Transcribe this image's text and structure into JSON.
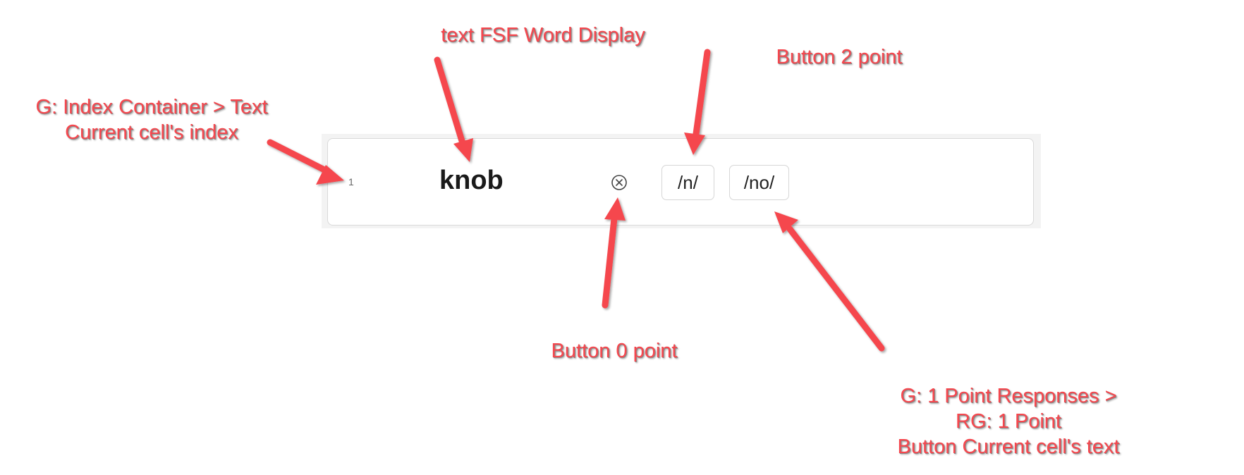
{
  "row": {
    "index": "1",
    "word": "knob",
    "zero_point_icon": "circle-x-icon",
    "two_point_label": "/n/",
    "one_point_label": "/no/"
  },
  "annotations": {
    "index_lines": [
      "G: Index Container > Text",
      "Current cell's index"
    ],
    "word_lines": [
      "text FSF Word Display"
    ],
    "two_point_lines": [
      "Button 2 point"
    ],
    "zero_point_lines": [
      "Button 0 point"
    ],
    "one_point_lines": [
      "G: 1 Point Responses >",
      "RG: 1 Point",
      "Button Current cell's text"
    ]
  },
  "colors": {
    "annotation": "#f5474e",
    "card_border": "#d9d9d9",
    "panel_bg": "#f3f3f3"
  }
}
